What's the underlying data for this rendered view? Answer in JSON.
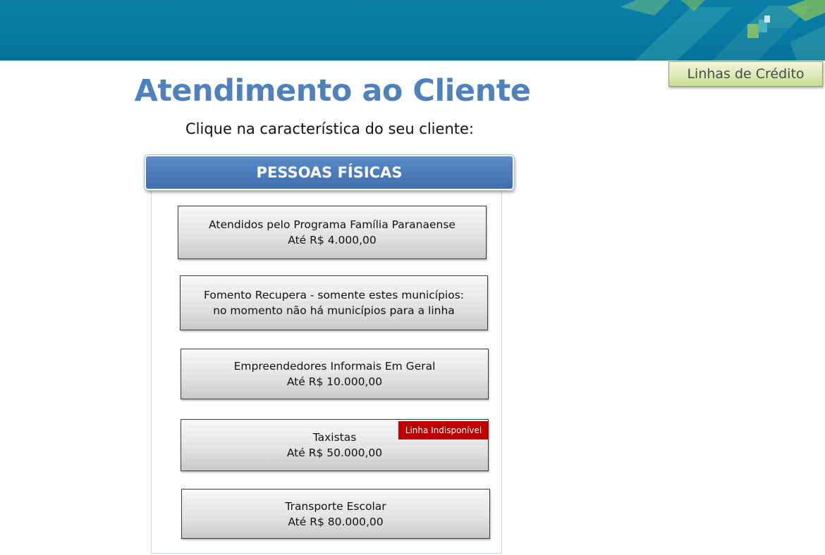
{
  "header": {
    "credit_lines_button": "Linhas de Crédito"
  },
  "main": {
    "title": "Atendimento ao Cliente",
    "subtitle": "Clique na característica do seu cliente:",
    "section_title": "PESSOAS FÍSICAS",
    "options": [
      {
        "line1": "Atendidos pelo Programa Família Paranaense",
        "line2": "Até R$ 4.000,00"
      },
      {
        "line1": "Fomento Recupera - somente estes municípios:",
        "line2": "no momento não há municípios para a linha"
      },
      {
        "line1": "Empreendedores  Informais Em Geral",
        "line2": "Até R$ 10.000,00"
      },
      {
        "line1": "Taxistas",
        "line2": "Até R$ 50.000,00",
        "badge": "Linha Indisponível"
      },
      {
        "line1": "Transporte Escolar",
        "line2": "Até R$ 80.000,00"
      }
    ]
  },
  "colors": {
    "banner": "#0679a3",
    "title": "#4f81bd",
    "section_bar": "#4b7cbd",
    "unavailable_badge": "#c00000",
    "credit_button": "#dde9b6"
  }
}
